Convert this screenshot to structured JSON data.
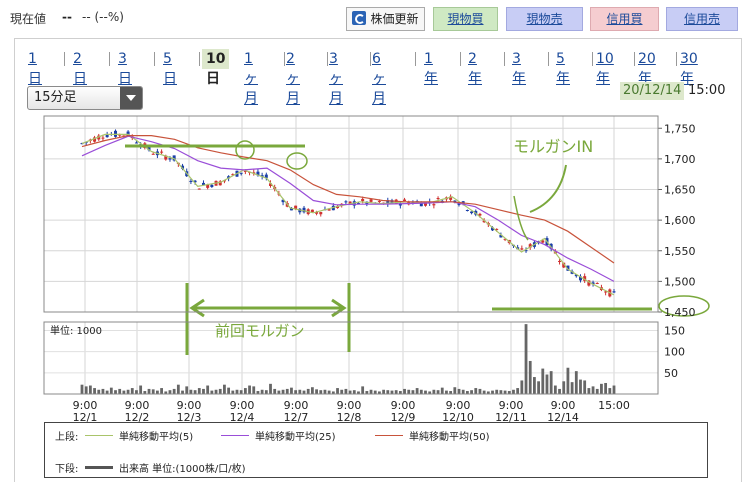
{
  "header": {
    "price_label": "現在値",
    "price_value": "--",
    "price_change": "-- (--%)",
    "update_button": "株価更新",
    "update_icon": "refresh-icon",
    "buttons": [
      "現物買",
      "現物売",
      "信用買",
      "信用売"
    ]
  },
  "periods": [
    "1日",
    "2日",
    "3日",
    "5日",
    "10日",
    "1ヶ月",
    "2ヶ月",
    "3ヶ月",
    "6ヶ月",
    "1年",
    "2年",
    "3年",
    "5年",
    "10年",
    "20年",
    "30年"
  ],
  "active_period": "10日",
  "interval_select": {
    "value": "15分足"
  },
  "chart_info": {
    "date": "20/12/14",
    "time": "15:00"
  },
  "annotations": {
    "morgan_in": "モルガンIN",
    "prev_morgan": "前回モルガン"
  },
  "volume_unit_label": "単位: 1000",
  "legend": {
    "upper_label": "上段:",
    "lower_label": "下段:",
    "ma5": "単純移動平均(5)",
    "ma25": "単純移動平均(25)",
    "ma50": "単純移動平均(50)",
    "volume": "出来高 単位:(1000株/口/枚)"
  },
  "colors": {
    "up": "#1b3fa8",
    "down": "#d03030",
    "ma5": "#a9c46a",
    "ma25": "#9a4ed8",
    "ma50": "#c8533b",
    "annotation": "#7aa83c"
  },
  "chart_data": [
    {
      "type": "line",
      "title": "",
      "x_tick_labels": [
        [
          "9:00",
          "12/1"
        ],
        [
          "9:00",
          "12/2"
        ],
        [
          "9:00",
          "12/3"
        ],
        [
          "9:00",
          "12/4"
        ],
        [
          "9:00",
          "12/7"
        ],
        [
          "9:00",
          "12/8"
        ],
        [
          "9:00",
          "12/9"
        ],
        [
          "9:00",
          "12/10"
        ],
        [
          "9:00",
          "12/11"
        ],
        [
          "9:00",
          "12/14"
        ],
        [
          "15:00",
          ""
        ]
      ],
      "y_ticks": [
        "1,750",
        "1,700",
        "1,650",
        "1,600",
        "1,550",
        "1,500",
        "1,450"
      ],
      "ylim": [
        1450,
        1770
      ],
      "grid": true,
      "series": [
        {
          "name": "単純移動平均(5)",
          "values": [
            1725,
            1740,
            1740,
            1712,
            1700,
            1655,
            1662,
            1682,
            1668,
            1620,
            1612,
            1622,
            1630,
            1627,
            1630,
            1628,
            1638,
            1612,
            1580,
            1548,
            1570,
            1520,
            1497,
            1478
          ]
        },
        {
          "name": "単純移動平均(25)",
          "values": [
            1705,
            1722,
            1737,
            1728,
            1717,
            1697,
            1685,
            1682,
            1685,
            1660,
            1632,
            1625,
            1626,
            1626,
            1627,
            1628,
            1630,
            1622,
            1600,
            1575,
            1560,
            1538,
            1520,
            1500
          ]
        },
        {
          "name": "単純移動平均(50)",
          "values": [
            1720,
            1730,
            1738,
            1738,
            1732,
            1718,
            1710,
            1703,
            1697,
            1682,
            1658,
            1642,
            1638,
            1632,
            1630,
            1630,
            1630,
            1626,
            1617,
            1608,
            1600,
            1582,
            1556,
            1530
          ]
        }
      ]
    },
    {
      "type": "bar",
      "title": "",
      "ylabel": "単位: 1000",
      "y_ticks": [
        "150",
        "100",
        "50"
      ],
      "ylim": [
        0,
        170
      ],
      "values": [
        22,
        18,
        20,
        14,
        10,
        12,
        8,
        15,
        9,
        12,
        8,
        10,
        14,
        9,
        20,
        7,
        12,
        11,
        8,
        14,
        6,
        9,
        12,
        22,
        8,
        18,
        10,
        9,
        14,
        12,
        20,
        8,
        10,
        12,
        22,
        15,
        8,
        10,
        9,
        14,
        20,
        18,
        7,
        10,
        9,
        24,
        12,
        8,
        10,
        12,
        15,
        9,
        10,
        8,
        12,
        16,
        11,
        9,
        10,
        8,
        6,
        14,
        10,
        12,
        8,
        9,
        6,
        18,
        7,
        10,
        8,
        6,
        10,
        9,
        8,
        9,
        7,
        12,
        10,
        9,
        14,
        10,
        8,
        6,
        10,
        9,
        15,
        8,
        7,
        16,
        12,
        10,
        7,
        9,
        14,
        12,
        8,
        6,
        8,
        10,
        9,
        8,
        7,
        10,
        14,
        32,
        165,
        78,
        40,
        30,
        60,
        46,
        54,
        20,
        12,
        30,
        62,
        28,
        54,
        34,
        32,
        14,
        18,
        12,
        24,
        26,
        14,
        20
      ]
    }
  ]
}
